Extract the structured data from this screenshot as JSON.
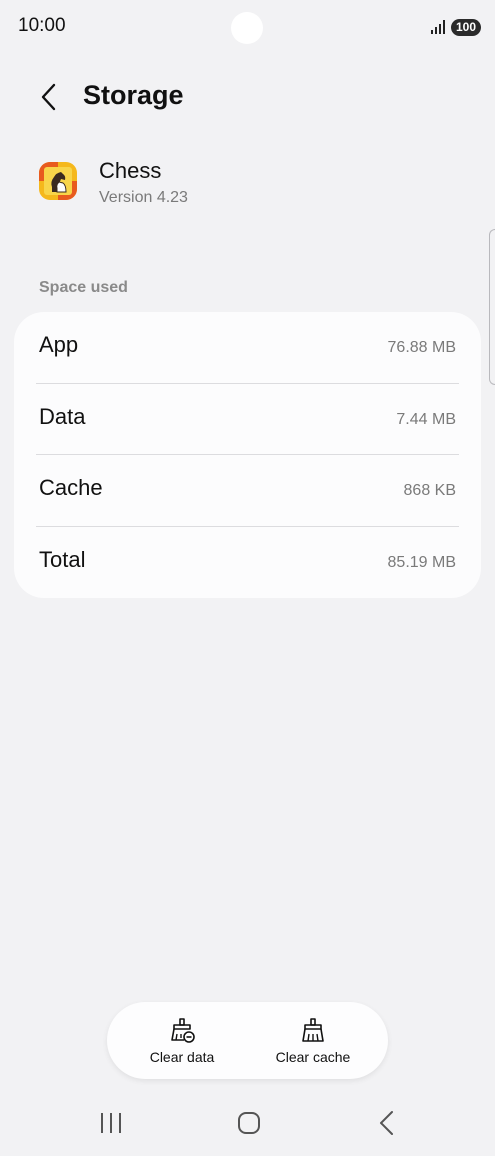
{
  "status_bar": {
    "time": "10:00",
    "battery": "100"
  },
  "header": {
    "title": "Storage"
  },
  "app": {
    "name": "Chess",
    "version": "Version 4.23"
  },
  "storage": {
    "section_label": "Space used",
    "rows": [
      {
        "label": "App",
        "value": "76.88 MB"
      },
      {
        "label": "Data",
        "value": "7.44 MB"
      },
      {
        "label": "Cache",
        "value": "868 KB"
      },
      {
        "label": "Total",
        "value": "85.19 MB"
      }
    ]
  },
  "actions": {
    "clear_data": "Clear data",
    "clear_cache": "Clear cache"
  },
  "colors": {
    "background": "#f2f2f4",
    "card": "#fcfcfd",
    "secondary_text": "#7a7a7a"
  },
  "icons": [
    "signal-icon",
    "back-arrow-icon",
    "chess-app-icon",
    "clear-data-icon",
    "clear-cache-icon",
    "recents-icon",
    "home-icon",
    "nav-back-icon"
  ]
}
